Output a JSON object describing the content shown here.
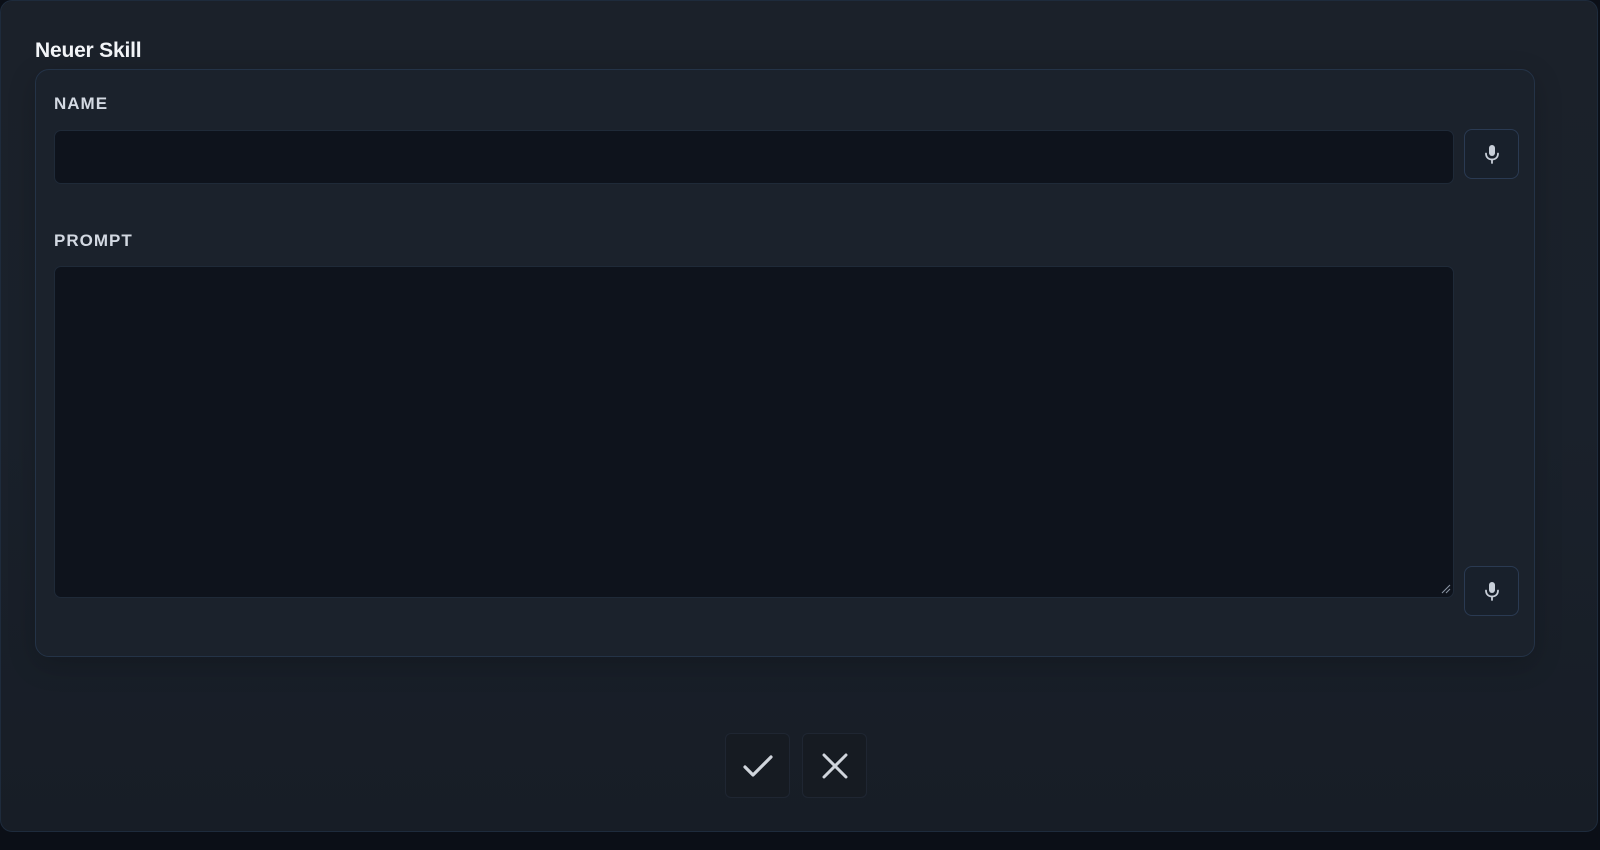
{
  "dialog": {
    "title": "Neuer Skill"
  },
  "form": {
    "name": {
      "label": "NAME",
      "value": "",
      "mic_icon": "microphone-icon"
    },
    "prompt": {
      "label": "PROMPT",
      "value": "",
      "mic_icon": "microphone-icon"
    }
  },
  "actions": {
    "confirm_icon": "check-icon",
    "cancel_icon": "close-icon"
  },
  "colors": {
    "background": "#1b212a",
    "input_background": "#0e131c",
    "panel_border": "#243347",
    "label_text": "#d3d9e2",
    "icon_color": "#c8cfd9"
  }
}
